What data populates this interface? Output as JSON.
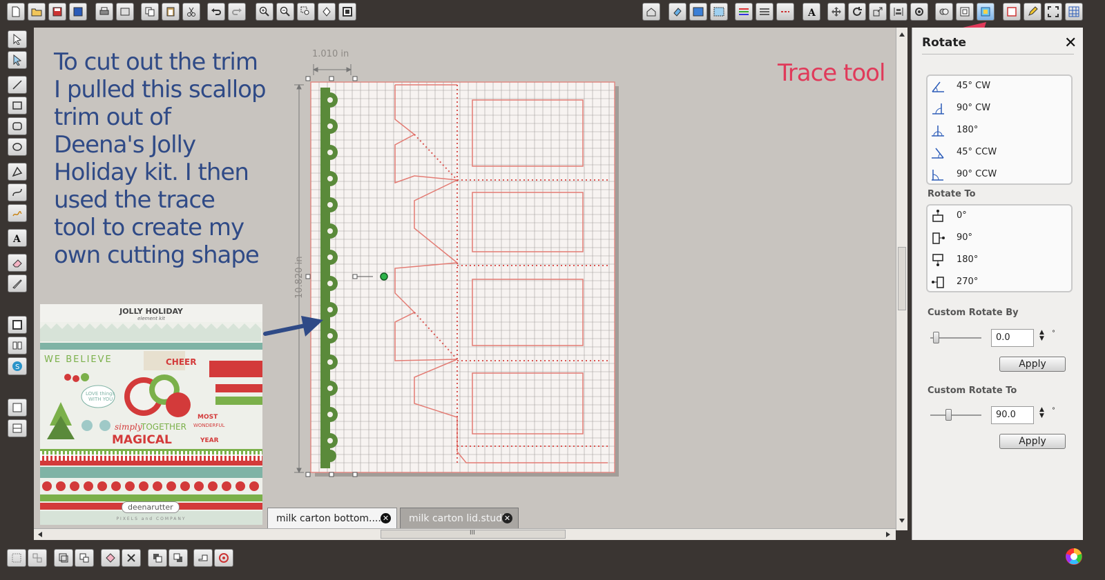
{
  "annotation": {
    "caption_lines": [
      "To cut out the trim",
      "I pulled this scallop",
      "trim out of",
      "Deena's  Jolly",
      "Holiday kit.  I then",
      "used the trace",
      "tool to create my",
      "own cutting shape"
    ],
    "trace_label": "Trace tool",
    "arrow_color": "#e03a5a",
    "caption_color": "#2f4a86"
  },
  "canvas": {
    "width_dim": "1.010 in",
    "height_dim": "10.820 in"
  },
  "kit_preview": {
    "title": "JOLLY HOLIDAY",
    "subtitle": "element kit",
    "brand": "deenarutter",
    "footer": "PIXELS and COMPANY"
  },
  "tabs": [
    {
      "label": "milk carton bottom....",
      "active": true
    },
    {
      "label": "milk carton lid.studio",
      "active": false
    }
  ],
  "panel": {
    "title": "Rotate",
    "rotate_by": [
      {
        "label": "45° CW",
        "icon": "rotate-45-cw-icon"
      },
      {
        "label": "90° CW",
        "icon": "rotate-90-cw-icon"
      },
      {
        "label": "180°",
        "icon": "rotate-180-icon"
      },
      {
        "label": "45° CCW",
        "icon": "rotate-45-ccw-icon"
      },
      {
        "label": "90° CCW",
        "icon": "rotate-90-ccw-icon"
      }
    ],
    "rotate_to_header": "Rotate To",
    "rotate_to": [
      {
        "label": "0°",
        "icon": "rotate-to-0-icon"
      },
      {
        "label": "90°",
        "icon": "rotate-to-90-icon"
      },
      {
        "label": "180°",
        "icon": "rotate-to-180-icon"
      },
      {
        "label": "270°",
        "icon": "rotate-to-270-icon"
      }
    ],
    "custom_rotate_by": {
      "header": "Custom Rotate By",
      "value": "0.0",
      "unit": "°",
      "apply": "Apply"
    },
    "custom_rotate_to": {
      "header": "Custom Rotate To",
      "value": "90.0",
      "unit": "°",
      "apply": "Apply"
    }
  },
  "scrollbar": {
    "h_thumb_grip": "III"
  }
}
